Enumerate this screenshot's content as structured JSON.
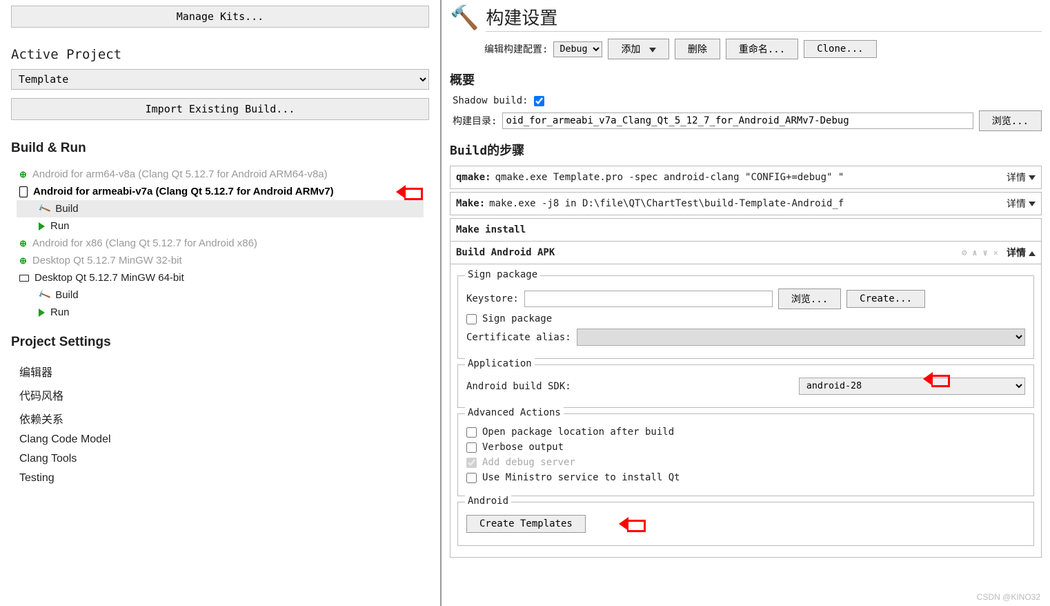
{
  "left": {
    "manage_kits": "Manage Kits...",
    "active_project_heading": "Active Project",
    "project_selected": "Template",
    "import_build": "Import Existing Build...",
    "build_run_heading": "Build & Run",
    "kits": {
      "k0": "Android for arm64-v8a (Clang Qt 5.12.7 for Android ARM64-v8a)",
      "k1": "Android for armeabi-v7a (Clang Qt 5.12.7 for Android ARMv7)",
      "k1_build": "Build",
      "k1_run": "Run",
      "k2": "Android for x86 (Clang Qt 5.12.7 for Android x86)",
      "k3": "Desktop Qt 5.12.7 MinGW 32-bit",
      "k4": "Desktop Qt 5.12.7 MinGW 64-bit",
      "k4_build": "Build",
      "k4_run": "Run"
    },
    "project_settings_heading": "Project Settings",
    "ps": {
      "editor": "编辑器",
      "codestyle": "代码风格",
      "deps": "依赖关系",
      "clang_model": "Clang Code Model",
      "clang_tools": "Clang Tools",
      "testing": "Testing"
    }
  },
  "right": {
    "title": "构建设置",
    "edit_config_label": "编辑构建配置:",
    "config_selected": "Debug",
    "btn_add": "添加",
    "btn_delete": "删除",
    "btn_rename": "重命名...",
    "btn_clone": "Clone...",
    "overview_heading": "概要",
    "shadow_build_label": "Shadow build:",
    "shadow_build_checked": true,
    "build_dir_label": "构建目录:",
    "build_dir_value": "oid_for_armeabi_v7a_Clang_Qt_5_12_7_for_Android_ARMv7-Debug",
    "browse": "浏览...",
    "steps_heading": "Build的步骤",
    "qmake_title": "qmake:",
    "qmake_text": "qmake.exe Template.pro -spec android-clang \"CONFIG+=debug\" \"",
    "make_title": "Make:",
    "make_text": "make.exe -j8 in D:\\file\\QT\\ChartTest\\build-Template-Android_f",
    "details": "详情",
    "make_install": "Make install",
    "build_apk_title": "Build Android APK",
    "sign_package_legend": "Sign package",
    "keystore_label": "Keystore:",
    "btn_create": "Create...",
    "sign_package_chk": "Sign package",
    "cert_alias_label": "Certificate alias:",
    "application_legend": "Application",
    "sdk_label": "Android build SDK:",
    "sdk_selected": "android-28",
    "advanced_legend": "Advanced Actions",
    "open_after": "Open package location after build",
    "verbose": "Verbose output",
    "add_debug": "Add debug server",
    "ministro": "Use Ministro service to install Qt",
    "android_legend": "Android",
    "create_templates": "Create Templates"
  },
  "watermark": "CSDN @KINO32"
}
